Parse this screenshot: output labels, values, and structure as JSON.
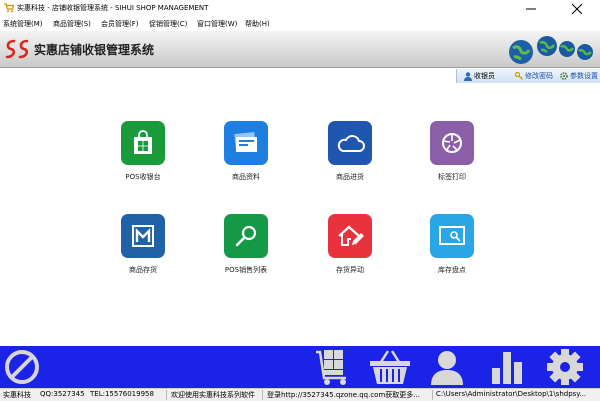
{
  "window": {
    "title": "实惠科技 - 店铺收银管理系统 - SIHUI SHOP MANAGEMENT"
  },
  "menu": [
    {
      "label": "系统管理(M)"
    },
    {
      "label": "商品管理(S)"
    },
    {
      "label": "会员管理(F)"
    },
    {
      "label": "促销管理(C)"
    },
    {
      "label": "窗口管理(W)"
    },
    {
      "label": "帮助(H)"
    }
  ],
  "banner": {
    "title": "实惠店铺收银管理系统"
  },
  "userbar": {
    "user_label": "收银员",
    "change_password": "修改密码",
    "settings": "参数设置"
  },
  "tiles": [
    {
      "label": "POS收银台",
      "icon": "shopping-bag-icon",
      "color": "#1a9a3a"
    },
    {
      "label": "商品资料",
      "icon": "cards-icon",
      "color": "#1e7fe0"
    },
    {
      "label": "商品进货",
      "icon": "cloud-icon",
      "color": "#1f56b0"
    },
    {
      "label": "标签打印",
      "icon": "aperture-icon",
      "color": "#8b5fa8"
    },
    {
      "label": "商品存货",
      "icon": "box-m-icon",
      "color": "#1f62a8"
    },
    {
      "label": "POS销售列表",
      "icon": "search-icon",
      "color": "#149a47"
    },
    {
      "label": "存货异动",
      "icon": "house-edit-icon",
      "color": "#e8333c"
    },
    {
      "label": "库存盘点",
      "icon": "monitor-icon",
      "color": "#2aa6e6"
    }
  ],
  "taskbar": [
    {
      "icon": "no-entry-icon"
    },
    {
      "icon": "cart-icon"
    },
    {
      "icon": "basket-icon"
    },
    {
      "icon": "person-icon"
    },
    {
      "icon": "bar-chart-icon"
    },
    {
      "icon": "gear-icon"
    }
  ],
  "status": {
    "company": "实惠科技",
    "qq": "QQ:3527345",
    "tel": "TEL:15576019958",
    "welcome": "欢迎使用实惠科技系列软件",
    "login": "登录http://3527345.qzone.qq.com获取更多...",
    "path": "C:\\Users\\Administrator\\Desktop\\1\\shdpsy..."
  }
}
